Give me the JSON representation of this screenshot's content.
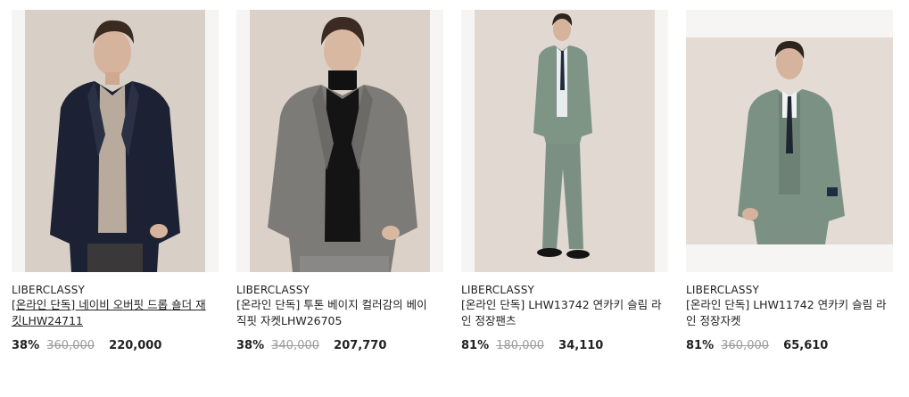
{
  "products": [
    {
      "brand": "LIBERCLASSY",
      "title": "[온라인 단독] 네이비 오버핏 드롭 숄더 재킷LHW24711",
      "discount": "38%",
      "original_price": "360,000",
      "price": "220,000"
    },
    {
      "brand": "LIBERCLASSY",
      "title": "[온라인 단독] 투톤 베이지 컬러감의 베이직핏 자켓LHW26705",
      "discount": "38%",
      "original_price": "340,000",
      "price": "207,770"
    },
    {
      "brand": "LIBERCLASSY",
      "title": "[온라인 단독] LHW13742 연카키 슬림 라인 정장팬츠",
      "discount": "81%",
      "original_price": "180,000",
      "price": "34,110"
    },
    {
      "brand": "LIBERCLASSY",
      "title": "[온라인 단독] LHW11742 연카키 슬림 라인 정장자켓",
      "discount": "81%",
      "original_price": "360,000",
      "price": "65,610"
    }
  ]
}
